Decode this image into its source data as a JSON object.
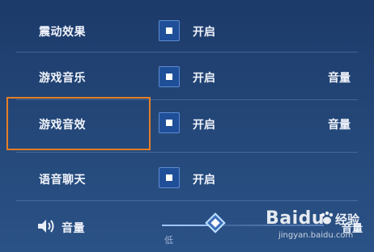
{
  "settings": {
    "rows": [
      {
        "label": "震动效果",
        "toggle": "开启",
        "volume": ""
      },
      {
        "label": "游戏音乐",
        "toggle": "开启",
        "volume": "音量"
      },
      {
        "label": "游戏音效",
        "toggle": "开启",
        "volume": "音量"
      },
      {
        "label": "语音聊天",
        "toggle": "开启",
        "volume": ""
      }
    ]
  },
  "volume": {
    "label": "音量",
    "low_label": "低",
    "right_label": "音量"
  },
  "watermark": {
    "brand": "Baidu",
    "product": "经验",
    "url": "jingyan.baidu.com"
  },
  "colors": {
    "highlight": "#e67e22",
    "checkbox": "#1f4f98",
    "background_top": "#1c3a6a",
    "background_bottom": "#2b5286"
  }
}
